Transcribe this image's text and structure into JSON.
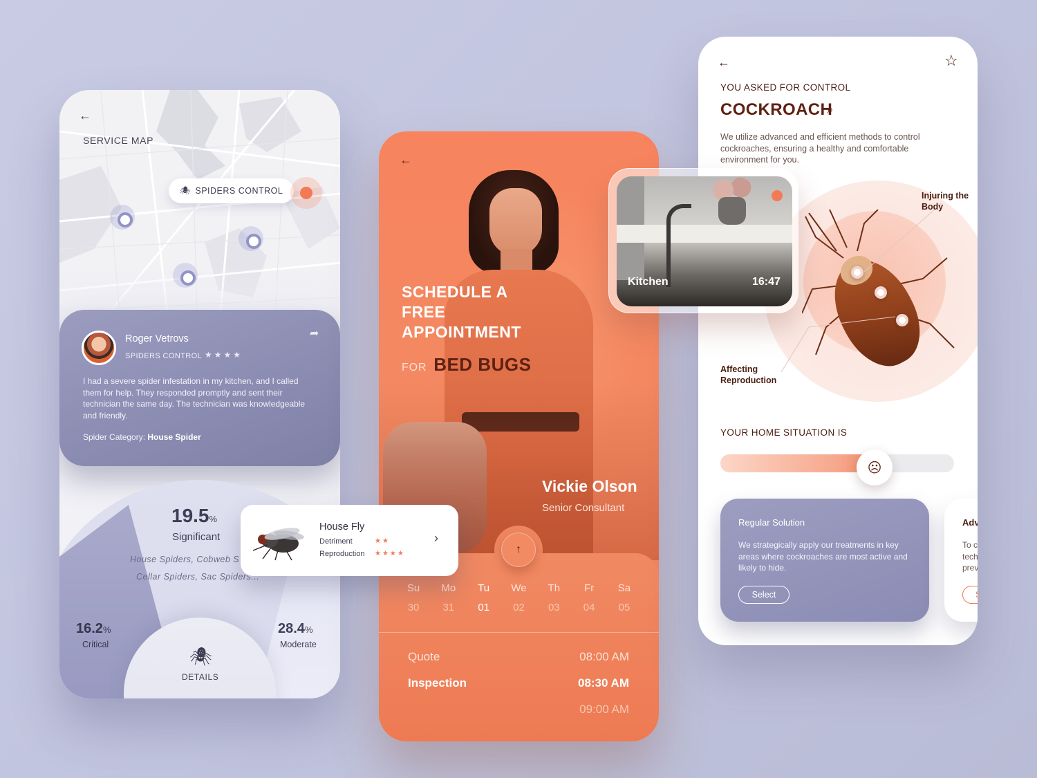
{
  "colors": {
    "accent": "#f47a57",
    "brand_dark": "#5e2112",
    "lavender": "#8b8cb4"
  },
  "icons": {
    "back": "arrow-left-icon",
    "share": "share-icon",
    "spider": "spider-icon",
    "star": "star-icon",
    "search": "search-icon",
    "up": "arrow-up-icon",
    "chevron": "chevron-right-icon",
    "angry": "angry-face-icon"
  },
  "service_map": {
    "title": "SERVICE MAP",
    "pill_label": "SPIDERS CONTROL",
    "review": {
      "name": "Roger Vetrovs",
      "category_tag": "SPIDERS CONTROL",
      "rating": 4,
      "stars": "★★★★",
      "text": "I had a severe spider infestation in my kitchen, and I called them for help. They responded promptly and sent their technician the same day. The technician was knowledgeable and friendly.",
      "category_label": "Spider Category:",
      "category_value": "House Spider"
    },
    "stats": {
      "main_value": "19.5",
      "main_label": "Significant",
      "species_line1": "House Spiders, Cobweb S",
      "species_line2": "Cellar Spiders, Sac Spiders...",
      "critical_value": "16.2",
      "critical_label": "Critical",
      "moderate_value": "28.4",
      "moderate_label": "Moderate",
      "percent_sign": "%",
      "details_label": "DETAILS"
    }
  },
  "fly_card": {
    "title": "House Fly",
    "detriment_label": "Detriment",
    "detriment_rating": 2,
    "detriment_stars": "★★",
    "reproduction_label": "Reproduction",
    "reproduction_rating": 4,
    "reproduction_stars": "★★★★"
  },
  "appointment": {
    "headline": "SCHEDULE A FREE APPOINTMENT",
    "for_word": "FOR",
    "pest": "BED BUGS",
    "consultant_name": "Vickie Olson",
    "consultant_role": "Senior Consultant",
    "days": [
      "Su",
      "Mo",
      "Tu",
      "We",
      "Th",
      "Fr",
      "Sa"
    ],
    "dates": [
      "30",
      "31",
      "01",
      "02",
      "03",
      "04",
      "05"
    ],
    "selected_date": "01",
    "slots": [
      {
        "label": "Quote",
        "time": "08:00 AM"
      },
      {
        "label": "Inspection",
        "time": "08:30 AM"
      },
      {
        "label": "",
        "time": "09:00 AM"
      }
    ]
  },
  "kitchen_card": {
    "label": "Kitchen",
    "time": "16:47"
  },
  "control": {
    "asked_label": "YOU ASKED FOR CONTROL",
    "pest_name": "COCKROACH",
    "description": "We utilize advanced and efficient methods to control cockroaches, ensuring a healthy and comfortable environment for you.",
    "callout_top": "Injuring the Body",
    "callout_bottom": "Affecting Reproduction",
    "situation_label": "YOUR HOME SITUATION IS",
    "situation_level": 0.66,
    "solutions": [
      {
        "title": "Regular Solution",
        "text": "We strategically apply our treatments in key areas where cockroaches are most active and likely to hide.",
        "button": "Select"
      },
      {
        "title": "Adv",
        "text": "To c tech prev",
        "button": "S"
      }
    ]
  }
}
